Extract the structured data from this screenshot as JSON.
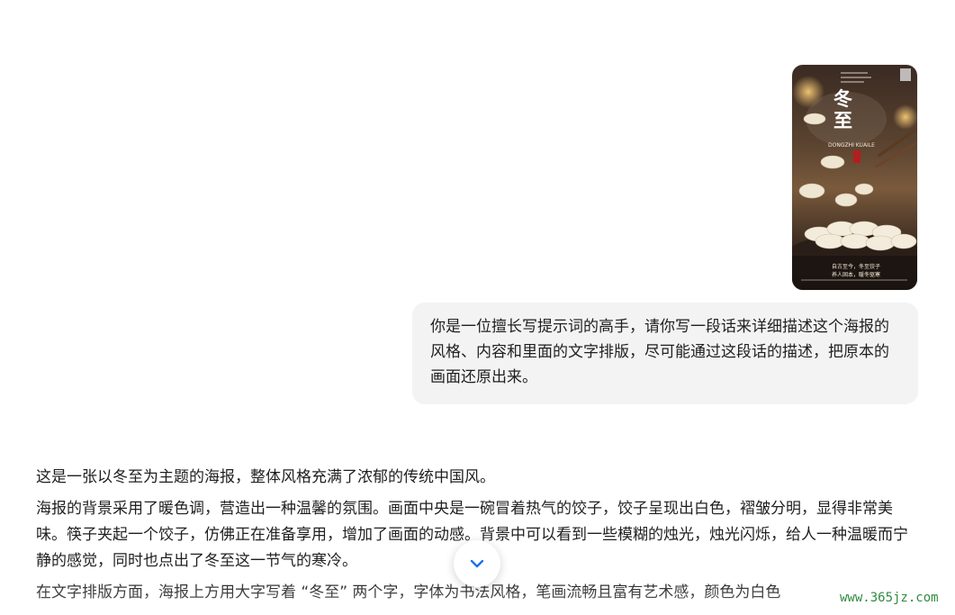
{
  "attachment": {
    "poster": {
      "title": "冬至",
      "subtitle": "DONGZHI KUAILE",
      "tagline_line1": "自古至今，冬至饺子",
      "tagline_line2": "养人固本，暖冬驱寒"
    }
  },
  "user_message": {
    "text": "你是一位擅长写提示词的高手，请你写一段话来详细描述这个海报的风格、内容和里面的文字排版，尽可能通过这段话的描述，把原本的画面还原出来。"
  },
  "assistant_reply": {
    "paragraphs": [
      "这是一张以冬至为主题的海报，整体风格充满了浓郁的传统中国风。",
      "海报的背景采用了暖色调，营造出一种温馨的氛围。画面中央是一碗冒着热气的饺子，饺子呈现出白色，褶皱分明，显得非常美味。筷子夹起一个饺子，仿佛正在准备享用，增加了画面的动感。背景中可以看到一些模糊的烛光，烛光闪烁，给人一种温暖而宁静的感觉，同时也点出了冬至这一节气的寒冷。",
      "在文字排版方面，海报上方用大字写着 “冬至” 两个字，字体为书法风格，笔画流畅且富有艺术感，颜色为白色"
    ]
  },
  "scroll_button": {
    "icon": "chevron-down-icon"
  },
  "watermark": {
    "text": "www.365jz.com"
  },
  "colors": {
    "bubble_bg": "#f3f3f3",
    "accent": "#1a73e8"
  }
}
